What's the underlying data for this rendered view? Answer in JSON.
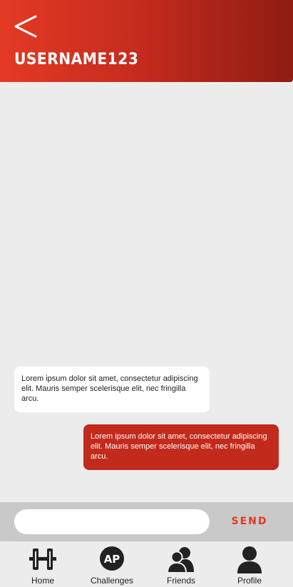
{
  "header": {
    "back_icon": "chevron-left-icon",
    "title": "USERNAME123"
  },
  "chat": {
    "messages": [
      {
        "direction": "incoming",
        "text": "Lorem ipsum dolor sit amet, consectetur adipiscing elit. Mauris semper scelerisque elit, nec fringilla arcu."
      },
      {
        "direction": "outgoing",
        "text": "Lorem ipsum dolor sit amet, consectetur adipiscing elit. Mauris semper scelerisque elit, nec fringilla arcu."
      }
    ]
  },
  "composer": {
    "input_value": "",
    "input_placeholder": "",
    "send_label": "SEND"
  },
  "nav": {
    "items": [
      {
        "label": "Home",
        "icon": "dumbbell-icon"
      },
      {
        "label": "Challenges",
        "icon": "ap-badge-icon"
      },
      {
        "label": "Friends",
        "icon": "friends-icon"
      },
      {
        "label": "Profile",
        "icon": "profile-icon"
      }
    ]
  },
  "colors": {
    "brand_red": "#e33a24",
    "brand_dark_red": "#8f1c12",
    "outgoing_bubble": "#c22a1c",
    "incoming_bubble": "#ffffff",
    "background": "#ececec",
    "composer_bar": "#c9c9c9"
  }
}
